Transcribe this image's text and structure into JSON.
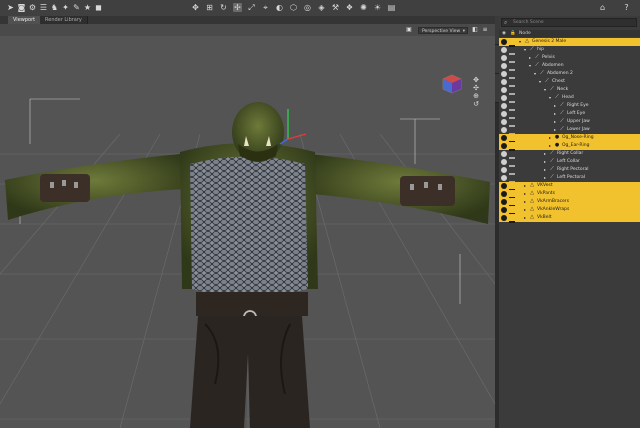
{
  "tabs": [
    {
      "label": "Viewport",
      "active": true
    },
    {
      "label": "Render Library",
      "active": false
    }
  ],
  "toolbar": {
    "left_tools": [
      "cursor-icon",
      "camera-icon",
      "gear-icon",
      "layers-icon",
      "figure-icon",
      "pose-icon",
      "brush-icon",
      "star-icon",
      "cube-icon"
    ],
    "center_tools": [
      "universal-tool-icon",
      "node-weight-icon",
      "rotate-icon",
      "translate-icon",
      "scale-icon",
      "move-joint-icon",
      "region-icon",
      "geometry-icon",
      "spot-render-icon",
      "surface-icon",
      "tool-icon",
      "render-icon",
      "iray-icon",
      "light-icon",
      "camera-view-icon"
    ],
    "right_tools": [
      "lock-icon",
      "help-icon"
    ]
  },
  "viewport": {
    "view_selector": "Perspective View"
  },
  "scene_panel": {
    "search_placeholder": "Search Scene",
    "column_header": "Node",
    "colors": {
      "selected": "#f2c22e",
      "panel": "#3b3b3b"
    },
    "rows": [
      {
        "label": "Genesis 2 Male",
        "depth": 0,
        "selected": true,
        "expanded": true,
        "icon": "figure-icon"
      },
      {
        "label": "hip",
        "depth": 1,
        "selected": false,
        "expanded": true,
        "icon": "bone-icon"
      },
      {
        "label": "Pelvis",
        "depth": 2,
        "selected": false,
        "expanded": false,
        "icon": "bone-icon"
      },
      {
        "label": "Abdomen",
        "depth": 2,
        "selected": false,
        "expanded": true,
        "icon": "bone-icon"
      },
      {
        "label": "Abdomen 2",
        "depth": 3,
        "selected": false,
        "expanded": true,
        "icon": "bone-icon"
      },
      {
        "label": "Chest",
        "depth": 4,
        "selected": false,
        "expanded": true,
        "icon": "bone-icon"
      },
      {
        "label": "Neck",
        "depth": 5,
        "selected": false,
        "expanded": true,
        "icon": "bone-icon"
      },
      {
        "label": "Head",
        "depth": 6,
        "selected": false,
        "expanded": true,
        "icon": "bone-icon"
      },
      {
        "label": "Right Eye",
        "depth": 7,
        "selected": false,
        "expanded": false,
        "icon": "bone-icon"
      },
      {
        "label": "Left Eye",
        "depth": 7,
        "selected": false,
        "expanded": false,
        "icon": "bone-icon"
      },
      {
        "label": "Upper Jaw",
        "depth": 7,
        "selected": false,
        "expanded": false,
        "icon": "bone-icon"
      },
      {
        "label": "Lower Jaw",
        "depth": 7,
        "selected": false,
        "expanded": false,
        "icon": "bone-icon"
      },
      {
        "label": "Og_Nose-Ring",
        "depth": 6,
        "selected": true,
        "expanded": false,
        "icon": "prop-icon"
      },
      {
        "label": "Og_Ear-Ring",
        "depth": 6,
        "selected": true,
        "expanded": false,
        "icon": "prop-icon"
      },
      {
        "label": "Right Collar",
        "depth": 5,
        "selected": false,
        "expanded": false,
        "icon": "bone-icon"
      },
      {
        "label": "Left Collar",
        "depth": 5,
        "selected": false,
        "expanded": false,
        "icon": "bone-icon"
      },
      {
        "label": "Right Pectoral",
        "depth": 5,
        "selected": false,
        "expanded": false,
        "icon": "bone-icon"
      },
      {
        "label": "Left Pectoral",
        "depth": 5,
        "selected": false,
        "expanded": false,
        "icon": "bone-icon"
      },
      {
        "label": "VKVest",
        "depth": 1,
        "selected": true,
        "expanded": false,
        "icon": "figure-icon"
      },
      {
        "label": "VkPants",
        "depth": 1,
        "selected": true,
        "expanded": false,
        "icon": "figure-icon"
      },
      {
        "label": "VkArmBracers",
        "depth": 1,
        "selected": true,
        "expanded": false,
        "icon": "figure-icon"
      },
      {
        "label": "VkAnkleWraps",
        "depth": 1,
        "selected": true,
        "expanded": false,
        "icon": "figure-icon"
      },
      {
        "label": "VkBelt",
        "depth": 1,
        "selected": true,
        "expanded": false,
        "icon": "figure-icon"
      }
    ]
  }
}
